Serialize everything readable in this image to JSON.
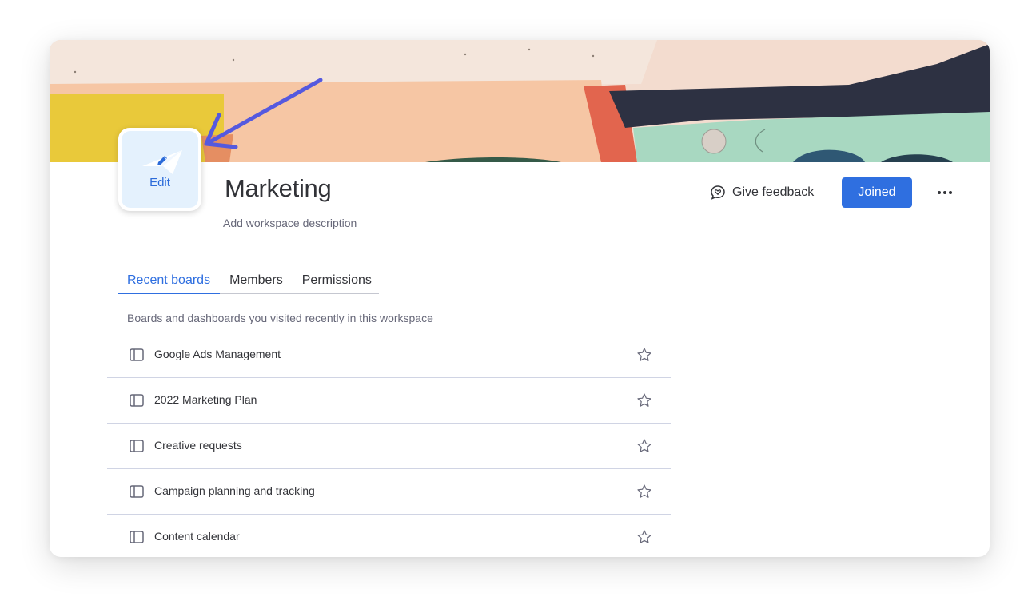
{
  "workspace": {
    "avatar_edit_label": "Edit",
    "title": "Marketing",
    "description_placeholder": "Add workspace description"
  },
  "header_actions": {
    "feedback_label": "Give feedback",
    "feedback_icon": "chat-heart-icon",
    "joined_label": "Joined",
    "more_icon": "more-horizontal-icon"
  },
  "tabs": [
    {
      "label": "Recent boards",
      "active": true
    },
    {
      "label": "Members",
      "active": false
    },
    {
      "label": "Permissions",
      "active": false
    }
  ],
  "recent_boards": {
    "subtitle": "Boards and dashboards you visited recently in this workspace",
    "items": [
      {
        "label": "Google Ads Management",
        "icon": "board-icon",
        "starred": false
      },
      {
        "label": "2022 Marketing Plan",
        "icon": "board-icon",
        "starred": false
      },
      {
        "label": "Creative requests",
        "icon": "board-icon",
        "starred": false
      },
      {
        "label": "Campaign planning and tracking",
        "icon": "board-icon",
        "starred": false
      },
      {
        "label": "Content calendar",
        "icon": "board-icon",
        "starred": false
      }
    ]
  },
  "colors": {
    "primary": "#2f6fe0",
    "text": "#323338",
    "secondary_text": "#676879",
    "annotation_arrow": "#5559df",
    "avatar_bg": "#e4f1fd"
  }
}
